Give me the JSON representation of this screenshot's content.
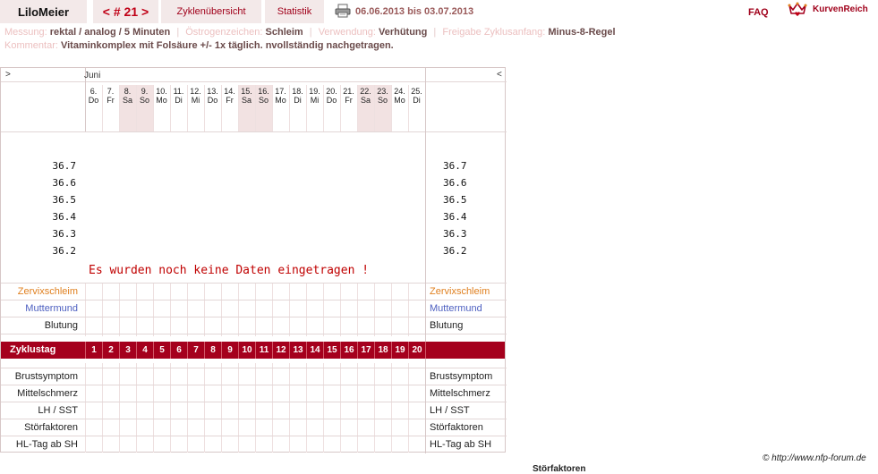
{
  "header": {
    "user": "LiloMeier",
    "cycle_nav": "< # 21 >",
    "tabs": [
      "Zyklenübersicht",
      "Statistik"
    ],
    "period": "06.06.2013 bis 03.07.2013",
    "faq": "FAQ",
    "brand": "KurvenReich",
    "print_icon": "printer-icon",
    "brand_icon": "crown-heart-icon"
  },
  "info": {
    "messung_label": "Messung:",
    "messung_value": "rektal / analog / 5 Minuten",
    "oestrogen_label": "Östrogenzeichen:",
    "oestrogen_value": "Schleim",
    "verwendung_label": "Verwendung:",
    "verwendung_value": "Verhütung",
    "freigabe_label": "Freigabe Zyklusanfang:",
    "freigabe_value": "Minus-8-Regel",
    "kommentar_label": "Kommentar:",
    "kommentar_value": "Vitaminkomplex mit Folsäure +/- 1x täglich. nvollständig nachgetragen."
  },
  "chart": {
    "nav_left": ">",
    "nav_right": "<",
    "month": "Juni",
    "days": [
      {
        "d": "6.",
        "w": "Do"
      },
      {
        "d": "7.",
        "w": "Fr"
      },
      {
        "d": "8.",
        "w": "Sa"
      },
      {
        "d": "9.",
        "w": "So"
      },
      {
        "d": "10.",
        "w": "Mo"
      },
      {
        "d": "11.",
        "w": "Di"
      },
      {
        "d": "12.",
        "w": "Mi"
      },
      {
        "d": "13.",
        "w": "Do"
      },
      {
        "d": "14.",
        "w": "Fr"
      },
      {
        "d": "15.",
        "w": "Sa"
      },
      {
        "d": "16.",
        "w": "So"
      },
      {
        "d": "17.",
        "w": "Mo"
      },
      {
        "d": "18.",
        "w": "Di"
      },
      {
        "d": "19.",
        "w": "Mi"
      },
      {
        "d": "20.",
        "w": "Do"
      },
      {
        "d": "21.",
        "w": "Fr"
      },
      {
        "d": "22.",
        "w": "Sa"
      },
      {
        "d": "23.",
        "w": "So"
      },
      {
        "d": "24.",
        "w": "Mo"
      },
      {
        "d": "25.",
        "w": "Di"
      }
    ],
    "temp_ticks": [
      "36.7",
      "36.6",
      "36.5",
      "36.4",
      "36.3",
      "36.2"
    ],
    "nodata": "Es wurden noch keine Daten eingetragen !",
    "rows_top": [
      "Zervixschleim",
      "Muttermund",
      "Blutung"
    ],
    "cycle_label": "Zyklustag",
    "cycle_days": [
      "1",
      "2",
      "3",
      "4",
      "5",
      "6",
      "7",
      "8",
      "9",
      "10",
      "11",
      "12",
      "13",
      "14",
      "15",
      "16",
      "17",
      "18",
      "19",
      "20"
    ],
    "rows_bottom": [
      "Brustsymptom",
      "Mittelschmerz",
      "LH / SST",
      "Störfaktoren",
      "HL-Tag ab SH"
    ]
  },
  "footer": {
    "copyright": "© http://www.nfp-forum.de",
    "cut_label": "Störfaktoren"
  },
  "colors": {
    "accent": "#a5001d",
    "zervix": "#e08020",
    "muttermund": "#4d5fc0",
    "weekend": "#f2e2e2"
  }
}
